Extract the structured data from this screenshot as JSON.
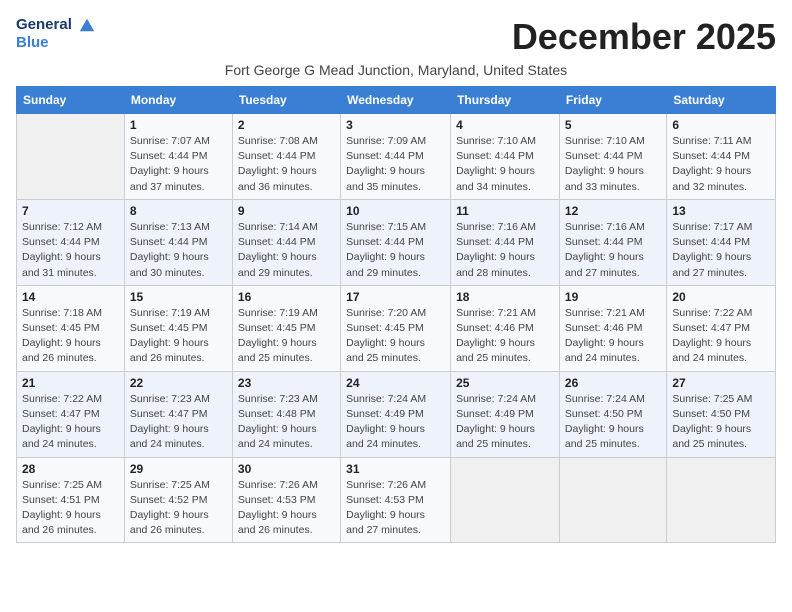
{
  "header": {
    "logo_line1": "General",
    "logo_line2": "Blue",
    "month_title": "December 2025",
    "location": "Fort George G Mead Junction, Maryland, United States"
  },
  "days_of_week": [
    "Sunday",
    "Monday",
    "Tuesday",
    "Wednesday",
    "Thursday",
    "Friday",
    "Saturday"
  ],
  "weeks": [
    [
      {
        "day": "",
        "info": ""
      },
      {
        "day": "1",
        "info": "Sunrise: 7:07 AM\nSunset: 4:44 PM\nDaylight: 9 hours\nand 37 minutes."
      },
      {
        "day": "2",
        "info": "Sunrise: 7:08 AM\nSunset: 4:44 PM\nDaylight: 9 hours\nand 36 minutes."
      },
      {
        "day": "3",
        "info": "Sunrise: 7:09 AM\nSunset: 4:44 PM\nDaylight: 9 hours\nand 35 minutes."
      },
      {
        "day": "4",
        "info": "Sunrise: 7:10 AM\nSunset: 4:44 PM\nDaylight: 9 hours\nand 34 minutes."
      },
      {
        "day": "5",
        "info": "Sunrise: 7:10 AM\nSunset: 4:44 PM\nDaylight: 9 hours\nand 33 minutes."
      },
      {
        "day": "6",
        "info": "Sunrise: 7:11 AM\nSunset: 4:44 PM\nDaylight: 9 hours\nand 32 minutes."
      }
    ],
    [
      {
        "day": "7",
        "info": "Sunrise: 7:12 AM\nSunset: 4:44 PM\nDaylight: 9 hours\nand 31 minutes."
      },
      {
        "day": "8",
        "info": "Sunrise: 7:13 AM\nSunset: 4:44 PM\nDaylight: 9 hours\nand 30 minutes."
      },
      {
        "day": "9",
        "info": "Sunrise: 7:14 AM\nSunset: 4:44 PM\nDaylight: 9 hours\nand 29 minutes."
      },
      {
        "day": "10",
        "info": "Sunrise: 7:15 AM\nSunset: 4:44 PM\nDaylight: 9 hours\nand 29 minutes."
      },
      {
        "day": "11",
        "info": "Sunrise: 7:16 AM\nSunset: 4:44 PM\nDaylight: 9 hours\nand 28 minutes."
      },
      {
        "day": "12",
        "info": "Sunrise: 7:16 AM\nSunset: 4:44 PM\nDaylight: 9 hours\nand 27 minutes."
      },
      {
        "day": "13",
        "info": "Sunrise: 7:17 AM\nSunset: 4:44 PM\nDaylight: 9 hours\nand 27 minutes."
      }
    ],
    [
      {
        "day": "14",
        "info": "Sunrise: 7:18 AM\nSunset: 4:45 PM\nDaylight: 9 hours\nand 26 minutes."
      },
      {
        "day": "15",
        "info": "Sunrise: 7:19 AM\nSunset: 4:45 PM\nDaylight: 9 hours\nand 26 minutes."
      },
      {
        "day": "16",
        "info": "Sunrise: 7:19 AM\nSunset: 4:45 PM\nDaylight: 9 hours\nand 25 minutes."
      },
      {
        "day": "17",
        "info": "Sunrise: 7:20 AM\nSunset: 4:45 PM\nDaylight: 9 hours\nand 25 minutes."
      },
      {
        "day": "18",
        "info": "Sunrise: 7:21 AM\nSunset: 4:46 PM\nDaylight: 9 hours\nand 25 minutes."
      },
      {
        "day": "19",
        "info": "Sunrise: 7:21 AM\nSunset: 4:46 PM\nDaylight: 9 hours\nand 24 minutes."
      },
      {
        "day": "20",
        "info": "Sunrise: 7:22 AM\nSunset: 4:47 PM\nDaylight: 9 hours\nand 24 minutes."
      }
    ],
    [
      {
        "day": "21",
        "info": "Sunrise: 7:22 AM\nSunset: 4:47 PM\nDaylight: 9 hours\nand 24 minutes."
      },
      {
        "day": "22",
        "info": "Sunrise: 7:23 AM\nSunset: 4:47 PM\nDaylight: 9 hours\nand 24 minutes."
      },
      {
        "day": "23",
        "info": "Sunrise: 7:23 AM\nSunset: 4:48 PM\nDaylight: 9 hours\nand 24 minutes."
      },
      {
        "day": "24",
        "info": "Sunrise: 7:24 AM\nSunset: 4:49 PM\nDaylight: 9 hours\nand 24 minutes."
      },
      {
        "day": "25",
        "info": "Sunrise: 7:24 AM\nSunset: 4:49 PM\nDaylight: 9 hours\nand 25 minutes."
      },
      {
        "day": "26",
        "info": "Sunrise: 7:24 AM\nSunset: 4:50 PM\nDaylight: 9 hours\nand 25 minutes."
      },
      {
        "day": "27",
        "info": "Sunrise: 7:25 AM\nSunset: 4:50 PM\nDaylight: 9 hours\nand 25 minutes."
      }
    ],
    [
      {
        "day": "28",
        "info": "Sunrise: 7:25 AM\nSunset: 4:51 PM\nDaylight: 9 hours\nand 26 minutes."
      },
      {
        "day": "29",
        "info": "Sunrise: 7:25 AM\nSunset: 4:52 PM\nDaylight: 9 hours\nand 26 minutes."
      },
      {
        "day": "30",
        "info": "Sunrise: 7:26 AM\nSunset: 4:53 PM\nDaylight: 9 hours\nand 26 minutes."
      },
      {
        "day": "31",
        "info": "Sunrise: 7:26 AM\nSunset: 4:53 PM\nDaylight: 9 hours\nand 27 minutes."
      },
      {
        "day": "",
        "info": ""
      },
      {
        "day": "",
        "info": ""
      },
      {
        "day": "",
        "info": ""
      }
    ]
  ]
}
